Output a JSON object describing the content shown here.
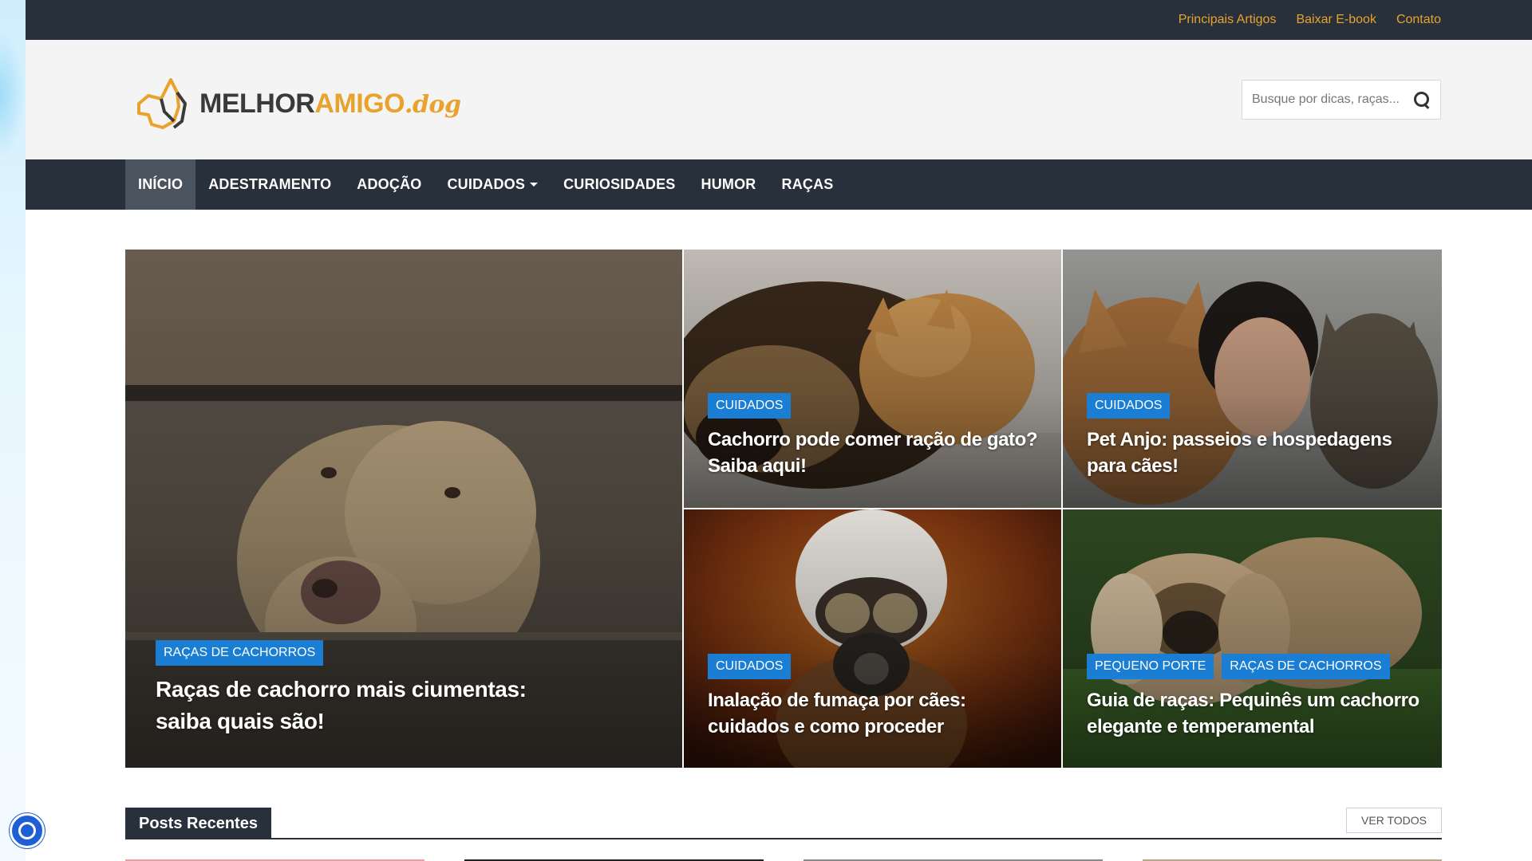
{
  "top_links": [
    "Principais Artigos",
    "Baixar E-book",
    "Contato"
  ],
  "logo": {
    "part1": "MELHOR",
    "part2": "AMIGO",
    "part3": ".dog"
  },
  "search": {
    "placeholder": "Busque por dicas, raças..."
  },
  "nav": {
    "items": [
      "INÍCIO",
      "ADESTRAMENTO",
      "ADOÇÃO",
      "CUIDADOS",
      "CURIOSIDADES",
      "HUMOR",
      "RAÇAS"
    ],
    "active": "INÍCIO"
  },
  "featured": [
    {
      "categories": [
        "RAÇAS DE CACHORROS"
      ],
      "title_line1": "Raças de cachorro mais ciumentas:",
      "title_line2": "saiba quais são!"
    },
    {
      "categories": [
        "CUIDADOS"
      ],
      "title_line1": "Cachorro pode comer ração de gato?",
      "title_line2": "Saiba aqui!"
    },
    {
      "categories": [
        "CUIDADOS"
      ],
      "title_line1": "Pet Anjo: passeios e hospedagens",
      "title_line2": "para cães!"
    },
    {
      "categories": [
        "CUIDADOS"
      ],
      "title_line1": "Inalação de fumaça por cães:",
      "title_line2": "cuidados e como proceder"
    },
    {
      "categories": [
        "PEQUENO PORTE",
        "RAÇAS DE CACHORROS"
      ],
      "title_line1": "Guia de raças: Pequinês um cachorro",
      "title_line2": "elegante e temperamental"
    }
  ],
  "recent": {
    "title": "Posts Recentes",
    "view_all": "VER TODOS"
  },
  "colors": {
    "accent": "#e9a22b",
    "dark": "#28313b",
    "badge": "#1a7fd4"
  }
}
